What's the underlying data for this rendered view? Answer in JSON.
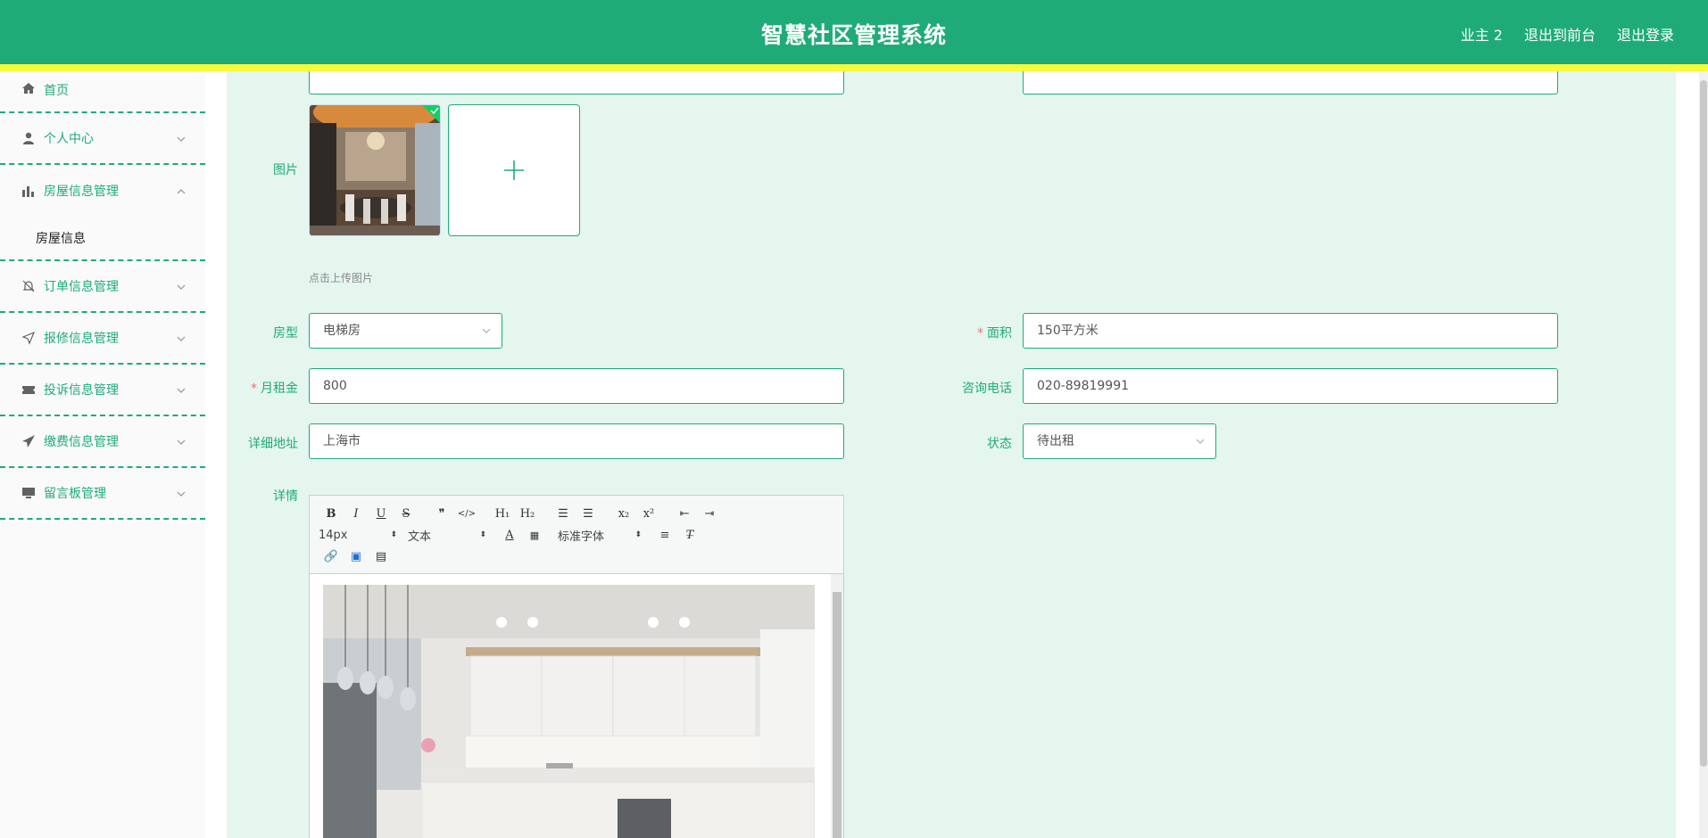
{
  "header": {
    "title": "智慧社区管理系统",
    "user": "业主 2",
    "front_link": "退出到前台",
    "logout_link": "退出登录"
  },
  "sidebar": {
    "items": [
      {
        "label": "首页",
        "icon": "home-icon"
      },
      {
        "label": "个人中心",
        "icon": "user-icon"
      },
      {
        "label": "房屋信息管理",
        "icon": "bar-chart-icon"
      },
      {
        "label": "订单信息管理",
        "icon": "bell-off-icon"
      },
      {
        "label": "报修信息管理",
        "icon": "send-icon"
      },
      {
        "label": "投诉信息管理",
        "icon": "ticket-icon"
      },
      {
        "label": "缴费信息管理",
        "icon": "paper-plane-icon"
      },
      {
        "label": "留言板管理",
        "icon": "monitor-icon"
      }
    ],
    "sub_item": "房屋信息"
  },
  "form": {
    "image_label": "图片",
    "upload_hint": "点击上传图片",
    "house_type_label": "房型",
    "house_type_value": "电梯房",
    "area_label": "面积",
    "area_value": "150平方米",
    "rent_label": "月租金",
    "rent_value": "800",
    "phone_label": "咨询电话",
    "phone_value": "020-89819991",
    "address_label": "详细地址",
    "address_value": "上海市",
    "status_label": "状态",
    "status_value": "待出租",
    "detail_label": "详情"
  },
  "editor": {
    "font_size": "14px",
    "paragraph": "文本",
    "font_family": "标准字体",
    "buttons": [
      "B",
      "I",
      "U",
      "S"
    ],
    "sub_label": "x₂",
    "sup_label": "x²",
    "h1_label": "H₁",
    "h2_label": "H₂"
  },
  "colors": {
    "primary": "#1fab78",
    "stripe": "#f6fb3c",
    "background": "#e5f6ef"
  }
}
